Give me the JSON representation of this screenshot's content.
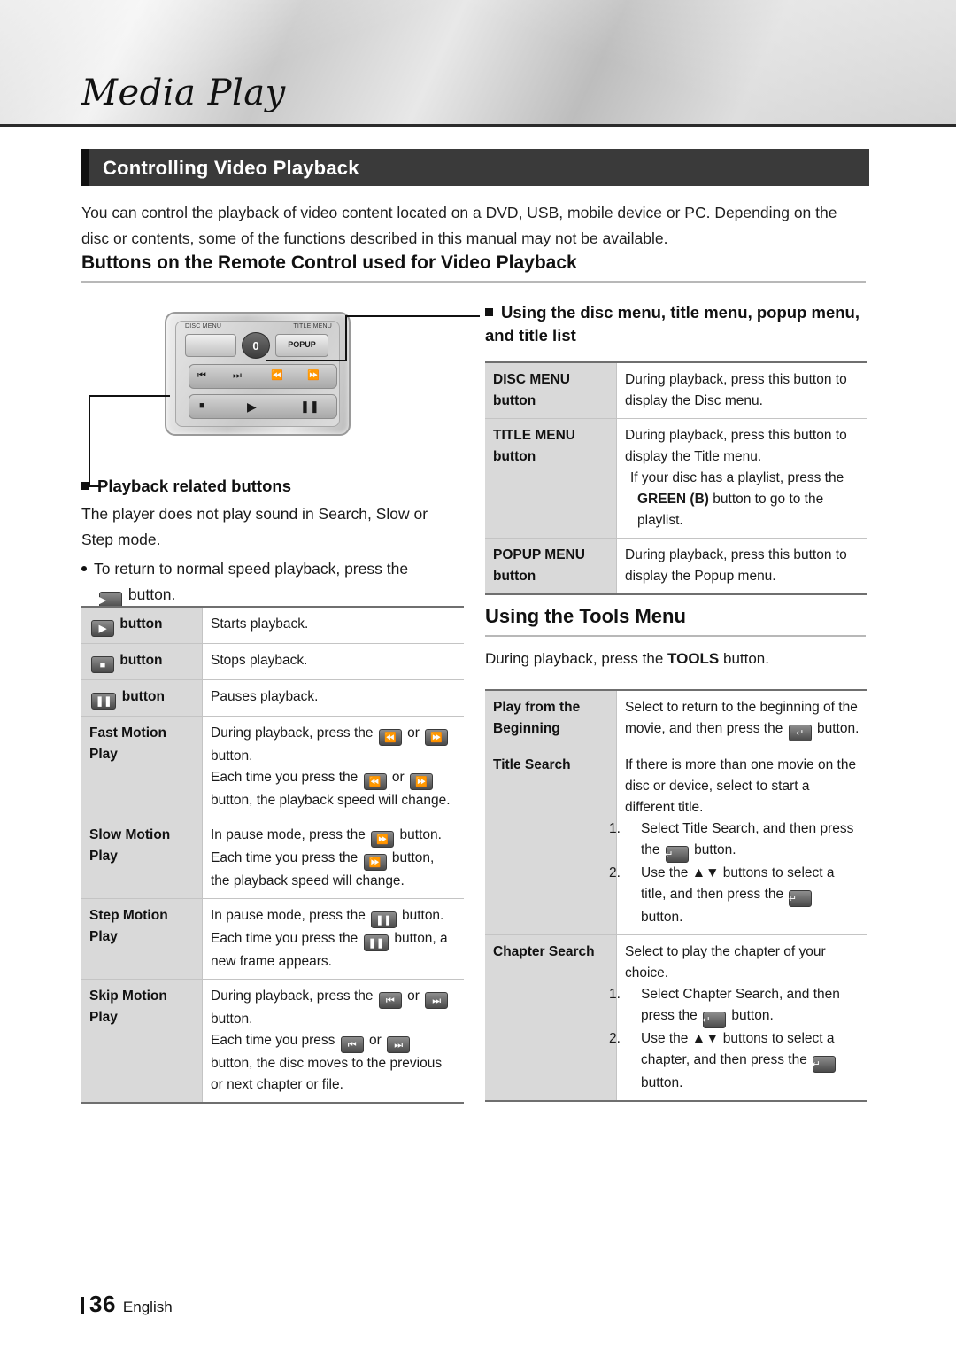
{
  "header": {
    "title": "Media Play"
  },
  "section": {
    "title": "Controlling Video Playback"
  },
  "intro": "You can control the playback of video content located on a DVD, USB, mobile device or PC. Depending on the disc or contents, some of the functions described in this manual may not be available.",
  "subhead": "Buttons on the Remote Control used for Video Playback",
  "remote": {
    "label_disc_menu": "DISC MENU",
    "label_title_menu": "TITLE MENU",
    "label_home": "0",
    "label_popup": "POPUP"
  },
  "left": {
    "bullet_heading": "Playback related buttons",
    "para1": "The player does not play sound in Search, Slow or Step mode.",
    "bullet1_a": "To return to normal speed playback, press the",
    "bullet1_b": "button.",
    "table": [
      {
        "key_icon": "play",
        "key": "button",
        "value": "Starts playback."
      },
      {
        "key_icon": "stop",
        "key": "button",
        "value": "Stops playback."
      },
      {
        "key_icon": "pause",
        "key": "button",
        "value": "Pauses playback."
      },
      {
        "key": "Fast Motion Play",
        "lines": [
          "During playback, press the  ◀◀  or  ▶▶  button.",
          "Each time you press the  ◀◀  or  ▶▶  button, the playback speed will change."
        ]
      },
      {
        "key": "Slow Motion Play",
        "lines": [
          "In pause mode, press the  ▶▶  button.",
          "Each time you press the  ▶▶  button, the playback speed will change."
        ]
      },
      {
        "key": "Step Motion Play",
        "lines": [
          "In pause mode, press the  ▮▮  button.",
          "Each time you press the  ▮▮  button, a new frame appears."
        ]
      },
      {
        "key": "Skip Motion Play",
        "lines": [
          "During playback, press the  |◀◀  or  ▶▶|  button.",
          "Each time you press  |◀◀  or  ▶▶|  button, the disc moves to the previous or next chapter or file."
        ]
      }
    ]
  },
  "right": {
    "bullet_heading": "Using the disc menu, title menu, popup menu, and title list",
    "menu_table": [
      {
        "key": "DISC MENU button",
        "value": "During playback, press this button to display the Disc menu."
      },
      {
        "key": "TITLE MENU button",
        "value": "During playback, press this button to display the Title menu.",
        "bullet": "If your disc has a playlist, press the",
        "bullet_strong": "GREEN (B)",
        "bullet_rest": "button to go to the playlist."
      },
      {
        "key": "POPUP MENU button",
        "value": "During playback, press this button to display the Popup menu."
      }
    ],
    "tools_heading": "Using the Tools Menu",
    "tools_line_a": "During playback, press the",
    "tools_line_b": "TOOLS",
    "tools_line_c": "button.",
    "tools_table": [
      {
        "key": "Play from the Beginning",
        "lines": [
          "Select to return to the beginning of the movie, and then press the ⏎ button."
        ]
      },
      {
        "key": "Title Search",
        "lines": [
          "If there is more than one movie on the disc or device, select to start a different title.",
          "1.  Select Title Search, and then press the ⏎ button.",
          "2.  Use the ▲▼ buttons to select a title, and then press the ⏎ button."
        ]
      },
      {
        "key": "Chapter Search",
        "lines": [
          "Select to play the chapter of your choice.",
          "1.  Select Chapter Search, and then press the ⏎ button.",
          "2.  Use the ▲▼ buttons to select a chapter, and then press the ⏎ button."
        ]
      }
    ]
  },
  "footer": {
    "page": "36",
    "language": "English"
  }
}
